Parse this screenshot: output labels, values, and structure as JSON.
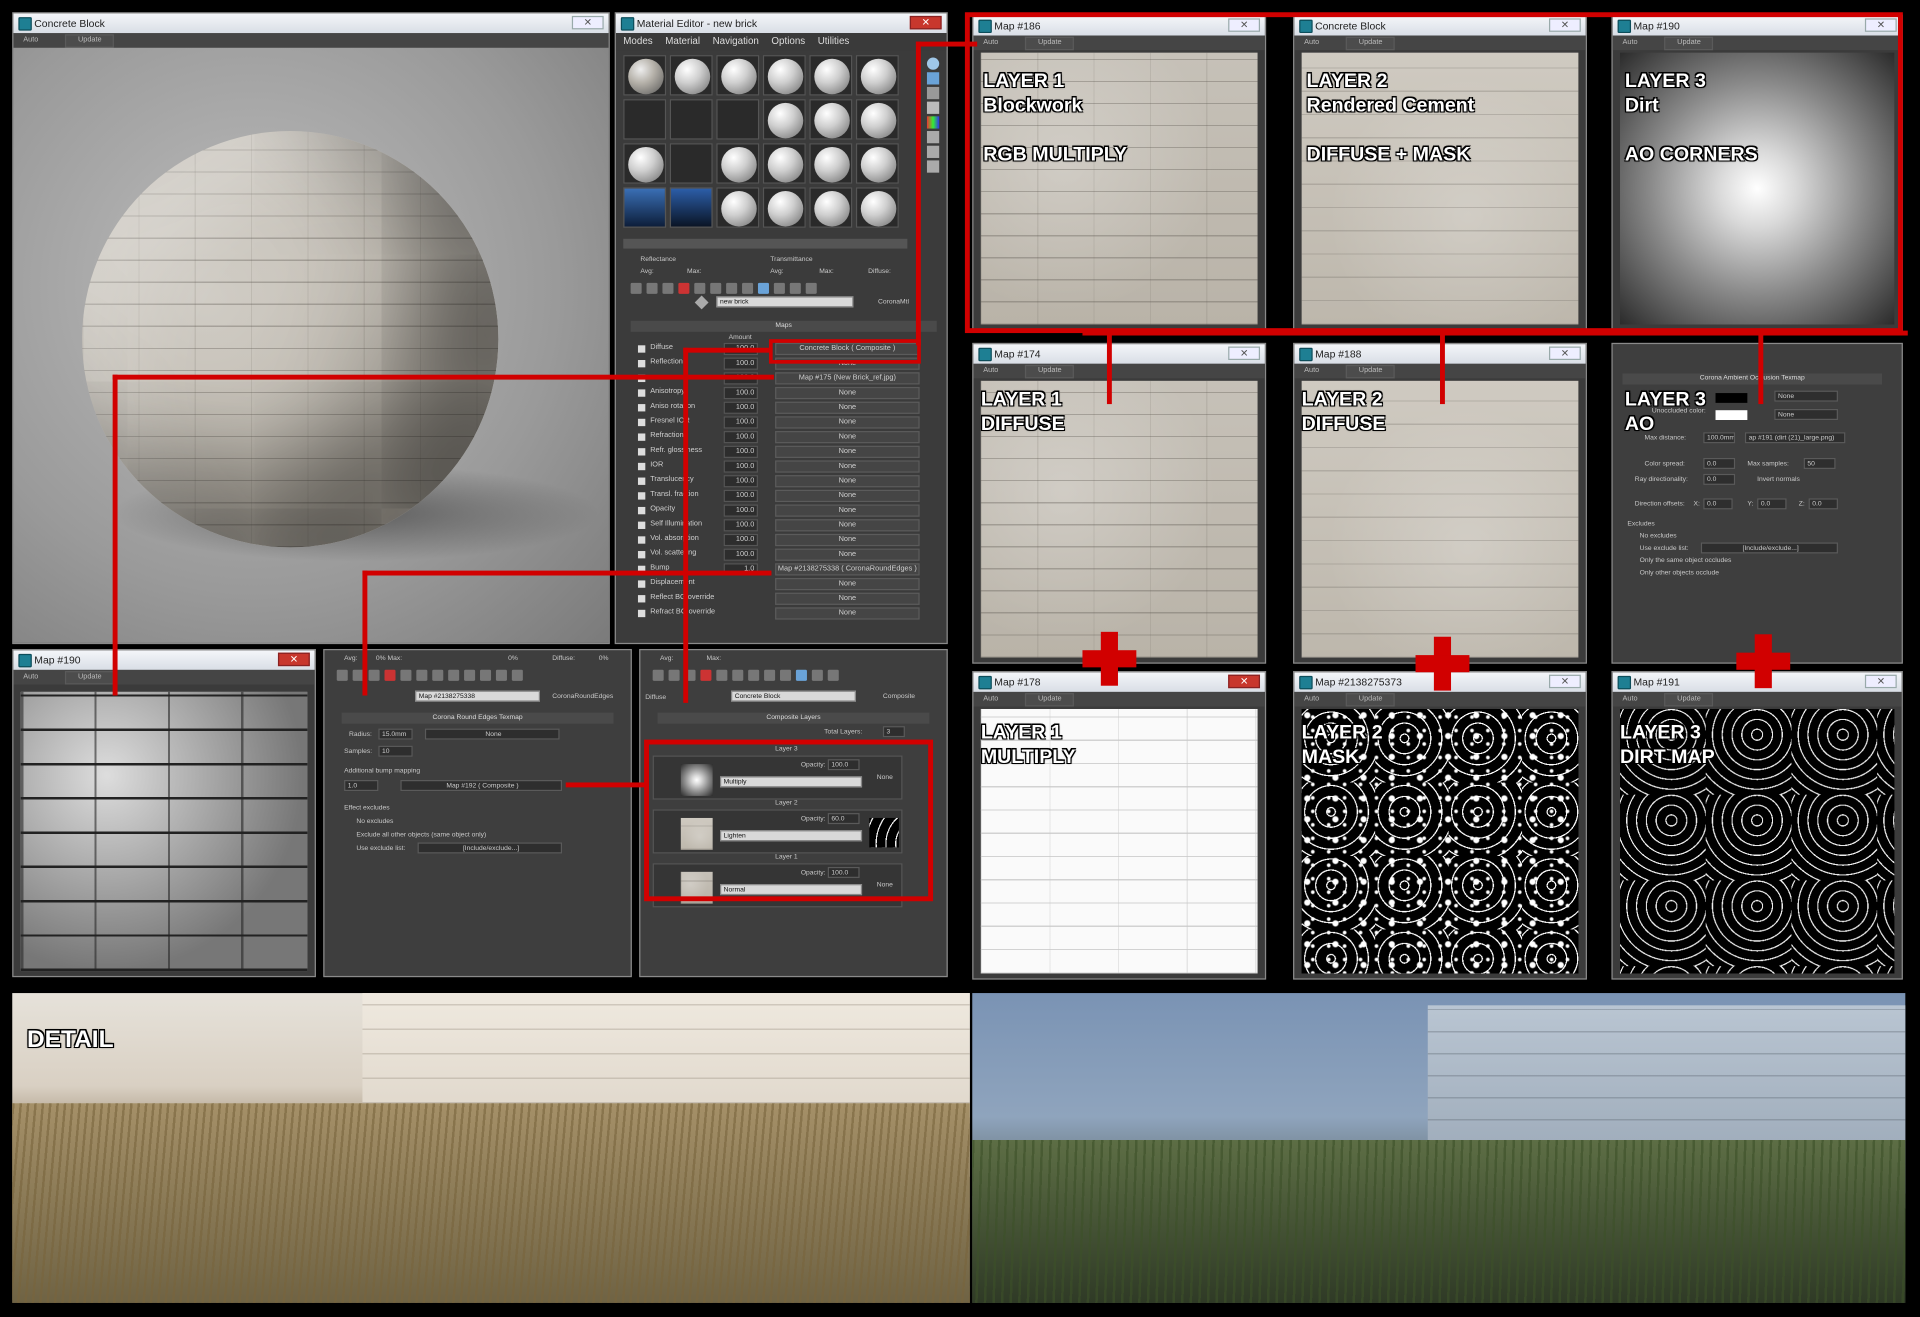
{
  "render_window": {
    "title": "Concrete Block",
    "auto": "Auto",
    "update": "Update"
  },
  "material_editor": {
    "title": "Material Editor - new brick",
    "menu": [
      "Modes",
      "Material",
      "Navigation",
      "Options",
      "Utilities"
    ],
    "reflectance": "Reflectance",
    "transmittance": "Transmittance",
    "avg": "Avg:",
    "max": "Max:",
    "diffuse_hdr": "Diffuse:",
    "material_name": "new brick",
    "material_type": "CoronaMtl",
    "maps_header": "Maps",
    "amount_header": "Amount",
    "rows": [
      {
        "name": "Diffuse",
        "amount": "100.0",
        "map": "Concrete Block  ( Composite )"
      },
      {
        "name": "Reflection",
        "amount": "100.0",
        "map": "None"
      },
      {
        "name": "",
        "amount": "100.0",
        "map": "Map #175 (New Brick_ref.jpg)"
      },
      {
        "name": "Anisotropy",
        "amount": "100.0",
        "map": "None"
      },
      {
        "name": "Aniso rotation",
        "amount": "100.0",
        "map": "None"
      },
      {
        "name": "Fresnel IOR",
        "amount": "100.0",
        "map": "None"
      },
      {
        "name": "Refraction",
        "amount": "100.0",
        "map": "None"
      },
      {
        "name": "Refr. glossiness",
        "amount": "100.0",
        "map": "None"
      },
      {
        "name": "IOR",
        "amount": "100.0",
        "map": "None"
      },
      {
        "name": "Translucency",
        "amount": "100.0",
        "map": "None"
      },
      {
        "name": "Transl. fraction",
        "amount": "100.0",
        "map": "None"
      },
      {
        "name": "Opacity",
        "amount": "100.0",
        "map": "None"
      },
      {
        "name": "Self Illumination",
        "amount": "100.0",
        "map": "None"
      },
      {
        "name": "Vol. absorption",
        "amount": "100.0",
        "map": "None"
      },
      {
        "name": "Vol. scattering",
        "amount": "100.0",
        "map": "None"
      },
      {
        "name": "Bump",
        "amount": "1.0",
        "map": "Map #2138275338  ( CoronaRoundEdges )"
      },
      {
        "name": "Displacement",
        "amount": "",
        "map": "None"
      },
      {
        "name": "Reflect BG override",
        "amount": "",
        "map": "None"
      },
      {
        "name": "Refract BG override",
        "amount": "",
        "map": "None"
      }
    ]
  },
  "map_windows": {
    "m186": {
      "title": "Map #186",
      "label": "LAYER 1\nBlockwork\n\nRGB MULTIPLY"
    },
    "concrete": {
      "title": "Concrete Block",
      "label": "LAYER 2\nRendered Cement\n\nDIFFUSE + MASK"
    },
    "m190top": {
      "title": "Map #190",
      "label": "LAYER 3\nDirt\n\nAO CORNERS"
    },
    "m174": {
      "title": "Map #174",
      "label": "LAYER 1\nDIFFUSE"
    },
    "m188": {
      "title": "Map #188",
      "label": "LAYER 2\nDIFFUSE"
    },
    "ao": {
      "title": "Corona Ambient Occlusion Texmap",
      "label": "LAYER 3\nAO"
    },
    "m178": {
      "title": "Map #178",
      "label": "LAYER 1\nMULTIPLY"
    },
    "m2138275373": {
      "title": "Map #2138275373",
      "label": "LAYER 2\nMASK"
    },
    "m191": {
      "title": "Map #191",
      "label": "LAYER 3\nDIRT MAP"
    },
    "m190bottom": {
      "title": "Map #190"
    }
  },
  "ao_panel": {
    "unoccluded": "Unoccluded color:",
    "occluded": "Occluded color:",
    "none": "None",
    "max_distance": "Max distance:",
    "max_distance_val": "100.0mm",
    "map_ref": "ap #191 (dirt (21)_large.png)",
    "color_spread": "Color spread:",
    "color_spread_val": "0.0",
    "max_samples": "Max samples:",
    "max_samples_val": "50",
    "ray_dir": "Ray directionality:",
    "ray_dir_val": "0.0",
    "invert": "Invert normals",
    "dir_offsets": "Direction offsets:",
    "x": "X:",
    "y": "Y:",
    "z": "Z:",
    "zero": "0.0",
    "excludes": "Excludes",
    "no_excludes": "No excludes",
    "use_exclude": "Use exclude list:",
    "include_exclude": "[Include/exclude...]",
    "only_same": "Only the same object occludes",
    "only_other": "Only other objects occlude"
  },
  "round_edges": {
    "avg": "Avg:",
    "avg_val": "0% Max:",
    "max_val": "0%",
    "diffuse": "Diffuse:",
    "diffuse_val": "0%",
    "map_name": "Map #2138275338",
    "type": "CoronaRoundEdges",
    "header": "Corona Round Edges Texmap",
    "radius": "Radius:",
    "radius_val": "15.0mm",
    "none": "None",
    "samples": "Samples:",
    "samples_val": "10",
    "bump": "Additional bump mapping",
    "bump_val": "1.0",
    "bump_map": "Map #192  ( Composite )",
    "effect_excludes": "Effect excludes",
    "no_excludes": "No excludes",
    "exclude_all": "Exclude all other objects (same object only)",
    "use_exclude": "Use exclude list:",
    "include_exclude": "[Include/exclude...]"
  },
  "composite": {
    "avg": "Avg:",
    "max": "Max:",
    "diffuse": "Diffuse",
    "name": "Concrete Block",
    "type": "Composite",
    "header": "Composite Layers",
    "total": "Total Layers:",
    "total_val": "3",
    "opacity": "Opacity:",
    "none": "None",
    "layers": [
      {
        "title": "Layer 3",
        "opacity": "100.0",
        "mode": "Multiply"
      },
      {
        "title": "Layer 2",
        "opacity": "60.0",
        "mode": "Lighten"
      },
      {
        "title": "Layer 1",
        "opacity": "100.0",
        "mode": "Normal"
      }
    ]
  },
  "detail_label": "DETAIL"
}
